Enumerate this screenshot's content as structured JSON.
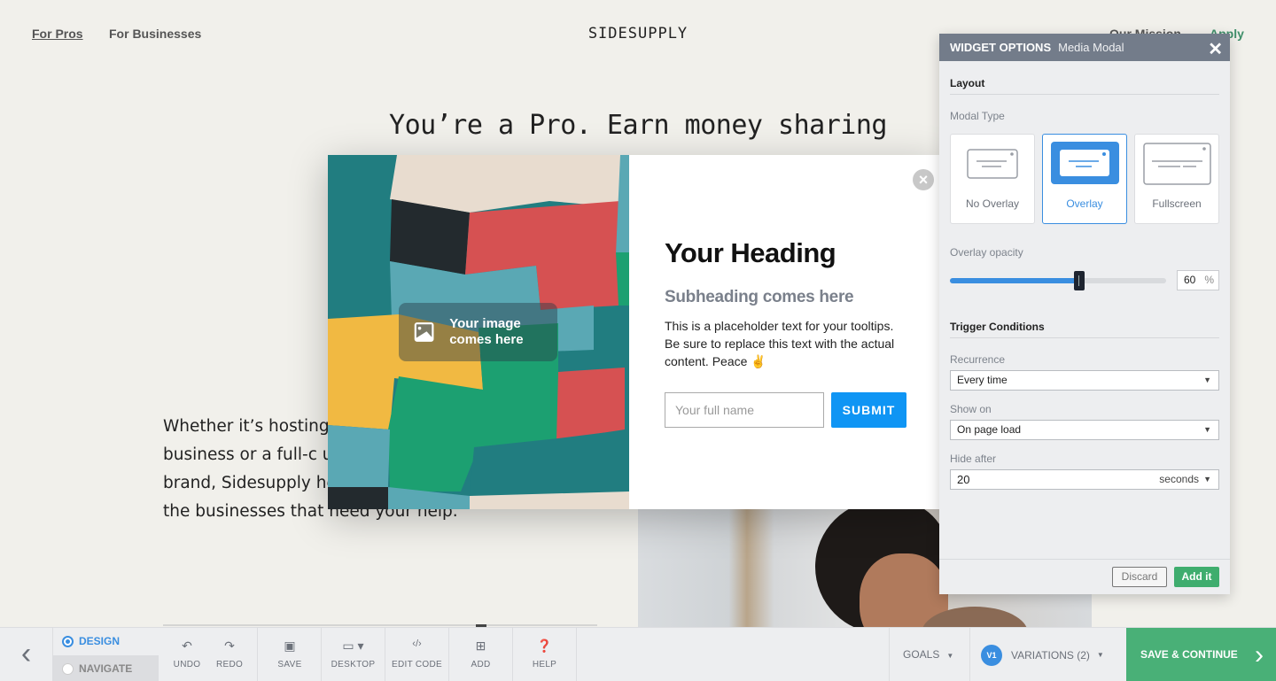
{
  "nav": {
    "for_pros": "For Pros",
    "for_businesses": "For Businesses",
    "logo": "SIDESUPPLY",
    "our_mission": "Our Mission",
    "apply": "Apply"
  },
  "hero": {
    "title": "You’re a Pro. Earn money sharing",
    "body": "Whether it’s hosting consultation sessions, a business or a full-c use Instagram to build a brand, Sidesupply helps you connect with the businesses that need your help."
  },
  "modal": {
    "image_placeholder": "Your image comes here",
    "close_icon": "×",
    "heading": "Your Heading",
    "subheading": "Subheading comes here",
    "body": "This is a placeholder text for your tooltips. Be sure to replace this text with the actual content. Peace ✌️",
    "input_placeholder": "Your full name",
    "submit_label": "SUBMIT",
    "colors": {
      "submit": "#0f95f4"
    }
  },
  "widget_panel": {
    "title": "WIDGET OPTIONS",
    "subtitle": "Media Modal",
    "close_icon": "✕",
    "layout_section": "Layout",
    "modal_type_label": "Modal Type",
    "modal_types": [
      {
        "label": "No Overlay",
        "selected": false
      },
      {
        "label": "Overlay",
        "selected": true
      },
      {
        "label": "Fullscreen",
        "selected": false
      }
    ],
    "overlay_opacity_label": "Overlay opacity",
    "overlay_opacity_value": "60",
    "overlay_opacity_percent": 60,
    "percent_unit": "%",
    "trigger_section": "Trigger Conditions",
    "recurrence_label": "Recurrence",
    "recurrence_value": "Every time",
    "show_on_label": "Show on",
    "show_on_value": "On page load",
    "hide_after_label": "Hide after",
    "hide_after_value": "20",
    "hide_after_unit": "seconds",
    "discard_label": "Discard",
    "add_label": "Add it",
    "colors": {
      "accent": "#3a8ee0",
      "add": "#3fad6e",
      "header": "#737c8a"
    }
  },
  "toolbar": {
    "back_icon": "‹",
    "design_label": "DESIGN",
    "navigate_label": "NAVIGATE",
    "undo_label": "UNDO",
    "redo_label": "REDO",
    "save_label": "SAVE",
    "desktop_label": "DESKTOP",
    "edit_code_label": "EDIT CODE",
    "add_label": "ADD",
    "help_label": "HELP",
    "goals_label": "GOALS",
    "variation_badge": "V1",
    "variations_label": "VARIATIONS (2)",
    "save_continue_label": "SAVE & CONTINUE",
    "colors": {
      "save_continue": "#49b077"
    }
  }
}
